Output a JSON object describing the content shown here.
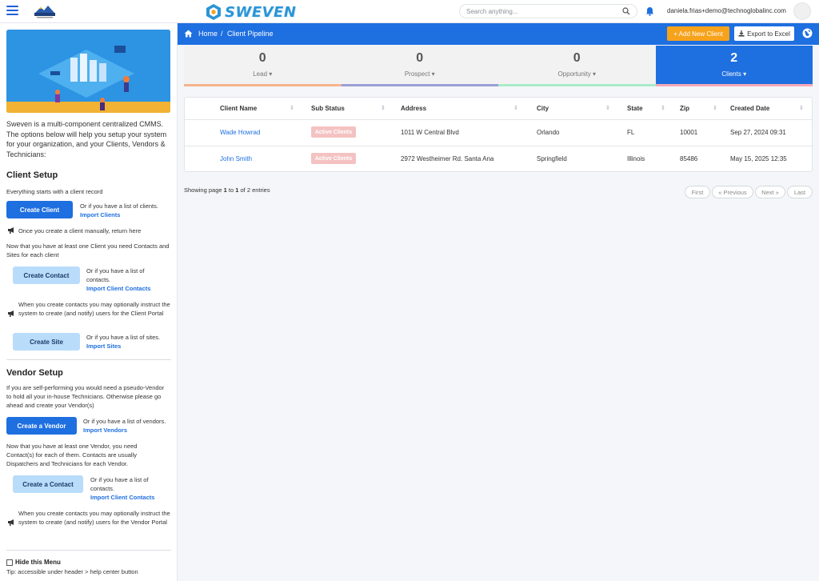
{
  "header": {
    "brand": "SWEVEN",
    "search_placeholder": "Search anything...",
    "user_email": "daniela.frias+demo@technoglobalinc.com"
  },
  "sidebar": {
    "intro": "Sweven is a multi-component centralized CMMS. The options below will help you setup your system for your organization, and your Clients, Vendors & Technicians:",
    "client_setup": {
      "title": "Client Setup",
      "line1": "Everything starts with a client record",
      "create_client": "Create Client",
      "create_client_note": "Or if you have a list of clients.",
      "import_clients": "Import Clients",
      "manual_note": "Once you create a client manually, return here",
      "contacts_intro": "Now that you have at least one Client you need Contacts and Sites for  each client",
      "create_contact": "Create Contact",
      "create_contact_note": "Or if you have a list of contacts.",
      "import_client_contacts": "Import Client Contacts",
      "portal_note": "When you create contacts you may optionally instruct the system to create (and notify) users for the Client Portal",
      "create_site": "Create Site",
      "create_site_note": "Or if you have a list of sites.",
      "import_sites": "Import Sites"
    },
    "vendor_setup": {
      "title": "Vendor Setup",
      "intro": "If you are self-performing you would need a pseudo-Vendor to hold all your in-house Technicians. Otherwise please go ahead and create your Vendor(s)",
      "create_vendor": "Create a Vendor",
      "create_vendor_note": "Or if you have a list of vendors.",
      "import_vendors": "Import Vendors",
      "contacts_intro": "Now that you have at least one Vendor, you need Contact(s) for each of them. Contacts are usually Dispatchers and Technicians for each Vendor.",
      "create_contact": "Create a Contact",
      "create_contact_note": "Or if you have a list of contacts.",
      "import_client_contacts": "Import Client Contacts",
      "portal_note": "When you create contacts you may optionally instruct the system to create (and notify) users for the Vendor Portal"
    },
    "hide_menu": "Hide this Menu",
    "tip": "Tip: accessible under header > help center button"
  },
  "breadcrumb": {
    "home": "Home",
    "separator": "/",
    "current": "Client Pipeline"
  },
  "actions": {
    "add_new_client": "+ Add New Client",
    "export_to_excel": "Export to Excel"
  },
  "stages": [
    {
      "count": "0",
      "label": "Lead ▾",
      "color": "#f5b58c"
    },
    {
      "count": "0",
      "label": "Prospect ▾",
      "color": "#9b9fd6"
    },
    {
      "count": "0",
      "label": "Opportunity ▾",
      "color": "#a8ecc9"
    },
    {
      "count": "2",
      "label": "Clients ▾",
      "color": "#f7a8b8"
    }
  ],
  "table": {
    "columns": [
      "Client Name",
      "Sub Status",
      "Address",
      "City",
      "State",
      "Zip",
      "Created Date"
    ],
    "rows": [
      {
        "name": "Wade Howrad",
        "status": "Active Clients",
        "address": "1011 W Central Blvd",
        "city": "Orlando",
        "state": "FL",
        "zip": "10001",
        "created": "Sep 27, 2024 09:31"
      },
      {
        "name": "John Smith",
        "status": "Active Clients",
        "address": "2972 Westheimer Rd. Santa Ana",
        "city": "Springfield",
        "state": "Illinois",
        "zip": "85486",
        "created": "May 15, 2025 12:35"
      }
    ]
  },
  "paging": {
    "showing_prefix": "Showing page ",
    "page": "1",
    "middle": " to ",
    "end": "1",
    "suffix": " of 2 entries",
    "first": "First",
    "previous": "« Previous",
    "next": "Next »",
    "last": "Last"
  },
  "colors": {
    "primary": "#1e6fe0",
    "accent": "#f7a21b",
    "badge": "#f4c2c2"
  }
}
